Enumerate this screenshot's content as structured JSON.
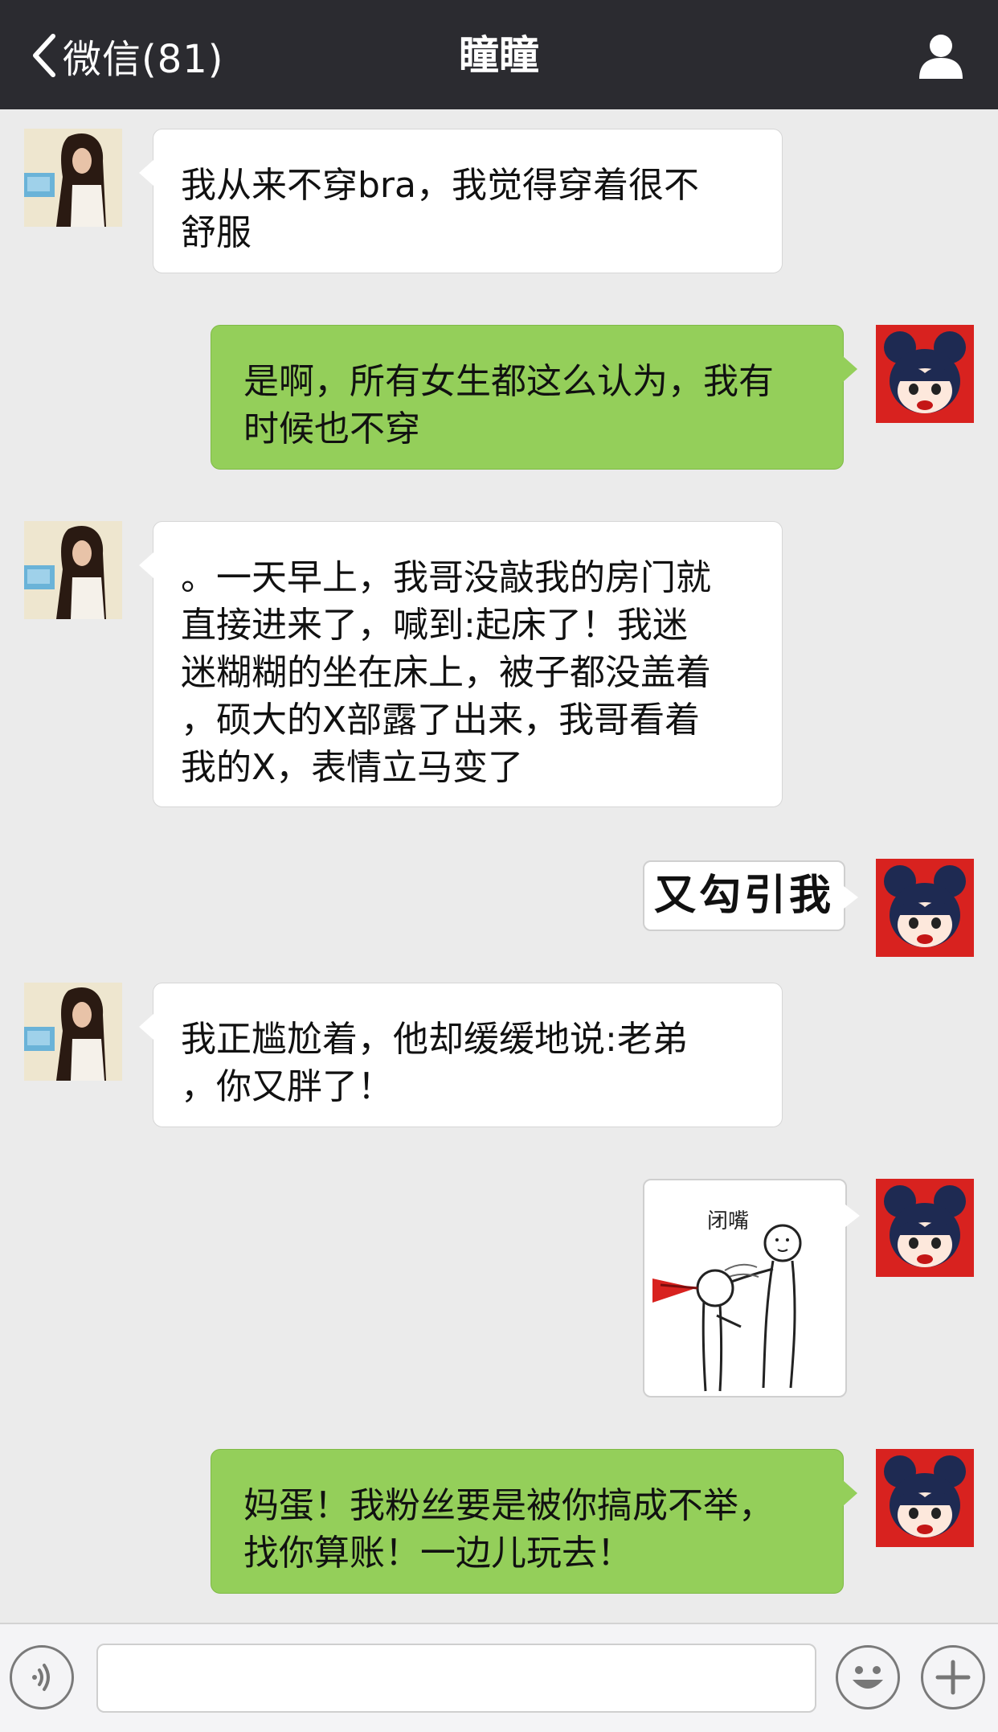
{
  "nav": {
    "back_label": "微信(81)",
    "title": "瞳瞳",
    "back_icon": "chevron-left-icon",
    "profile_icon": "person-icon"
  },
  "messages": [
    {
      "side": "left",
      "kind": "text",
      "text": "我从来不穿bra，我觉得穿着很不\n舒服"
    },
    {
      "side": "right",
      "kind": "text",
      "text": "是啊，所有女生都这么认为，我有\n时候也不穿"
    },
    {
      "side": "left",
      "kind": "text",
      "text": "。一天早上，我哥没敲我的房门就\n直接进来了，喊到:起床了！我迷\n迷糊糊的坐在床上，被子都没盖着\n，硕大的X部露了出来，我哥看着\n我的X，表情立马变了"
    },
    {
      "side": "right",
      "kind": "sticker",
      "text": "又勾引我"
    },
    {
      "side": "left",
      "kind": "text",
      "text": "我正尴尬着，他却缓缓地说:老弟\n，你又胖了！"
    },
    {
      "side": "right",
      "kind": "sticker",
      "caption": "闭嘴"
    },
    {
      "side": "right",
      "kind": "text",
      "text": "妈蛋！我粉丝要是被你搞成不举，\n找你算账！一边儿玩去！"
    }
  ],
  "colors": {
    "nav_bg": "#2b2b30",
    "chat_bg": "#ebebeb",
    "bubble_mine": "#94cf5a",
    "bubble_theirs": "#ffffff",
    "avatar_me_bg": "#d8221f"
  },
  "bottom_bar": {
    "voice_icon": "voice-icon",
    "emoji_icon": "emoji-icon",
    "plus_icon": "plus-icon"
  }
}
